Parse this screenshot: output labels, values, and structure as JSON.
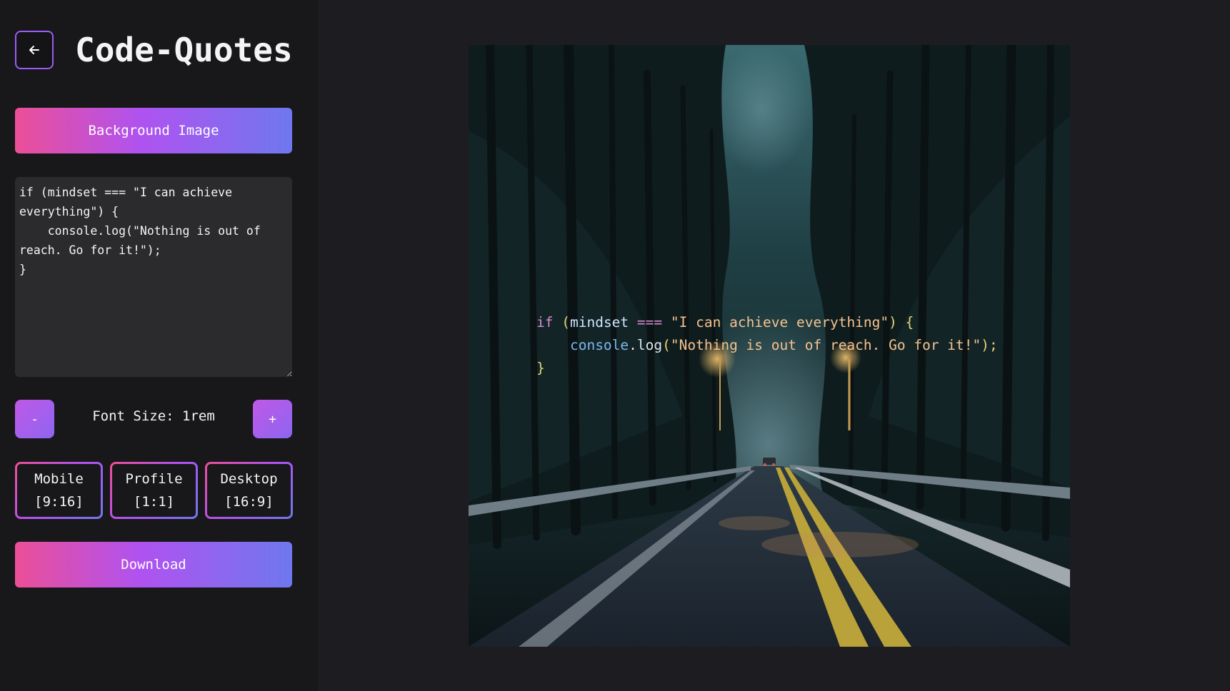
{
  "app": {
    "title": "Code-Quotes",
    "back_icon": "arrow-left-icon"
  },
  "controls": {
    "background_button_label": "Background Image",
    "code_text": "if (mindset === \"I can achieve everything\") {\n    console.log(\"Nothing is out of reach. Go for it!\");\n}",
    "font_decrease_label": "-",
    "font_increase_label": "+",
    "font_size_label": "Font Size: 1rem",
    "ratios": [
      {
        "name": "Mobile",
        "ratio": "[9:16]"
      },
      {
        "name": "Profile",
        "ratio": "[1:1]"
      },
      {
        "name": "Desktop",
        "ratio": "[16:9]"
      }
    ],
    "download_label": "Download"
  },
  "preview": {
    "line1": {
      "kw": "if",
      "open_paren": "(",
      "var": "mindset",
      "op": "===",
      "str": "\"I can achieve everything\"",
      "close_paren": ")",
      "brace": "{"
    },
    "line2": {
      "obj": "console",
      "dot": ".",
      "fn": "log",
      "open_paren": "(",
      "str": "\"Nothing is out of reach. Go for it!\"",
      "close": ");"
    },
    "line3": {
      "brace": "}"
    },
    "image_subject": "night forest road"
  },
  "colors": {
    "accent_pink": "#ec4f97",
    "accent_purple": "#b052f0",
    "accent_blue": "#6f78ee",
    "sidebar_bg": "#18181b",
    "page_bg": "#1d1d21"
  }
}
